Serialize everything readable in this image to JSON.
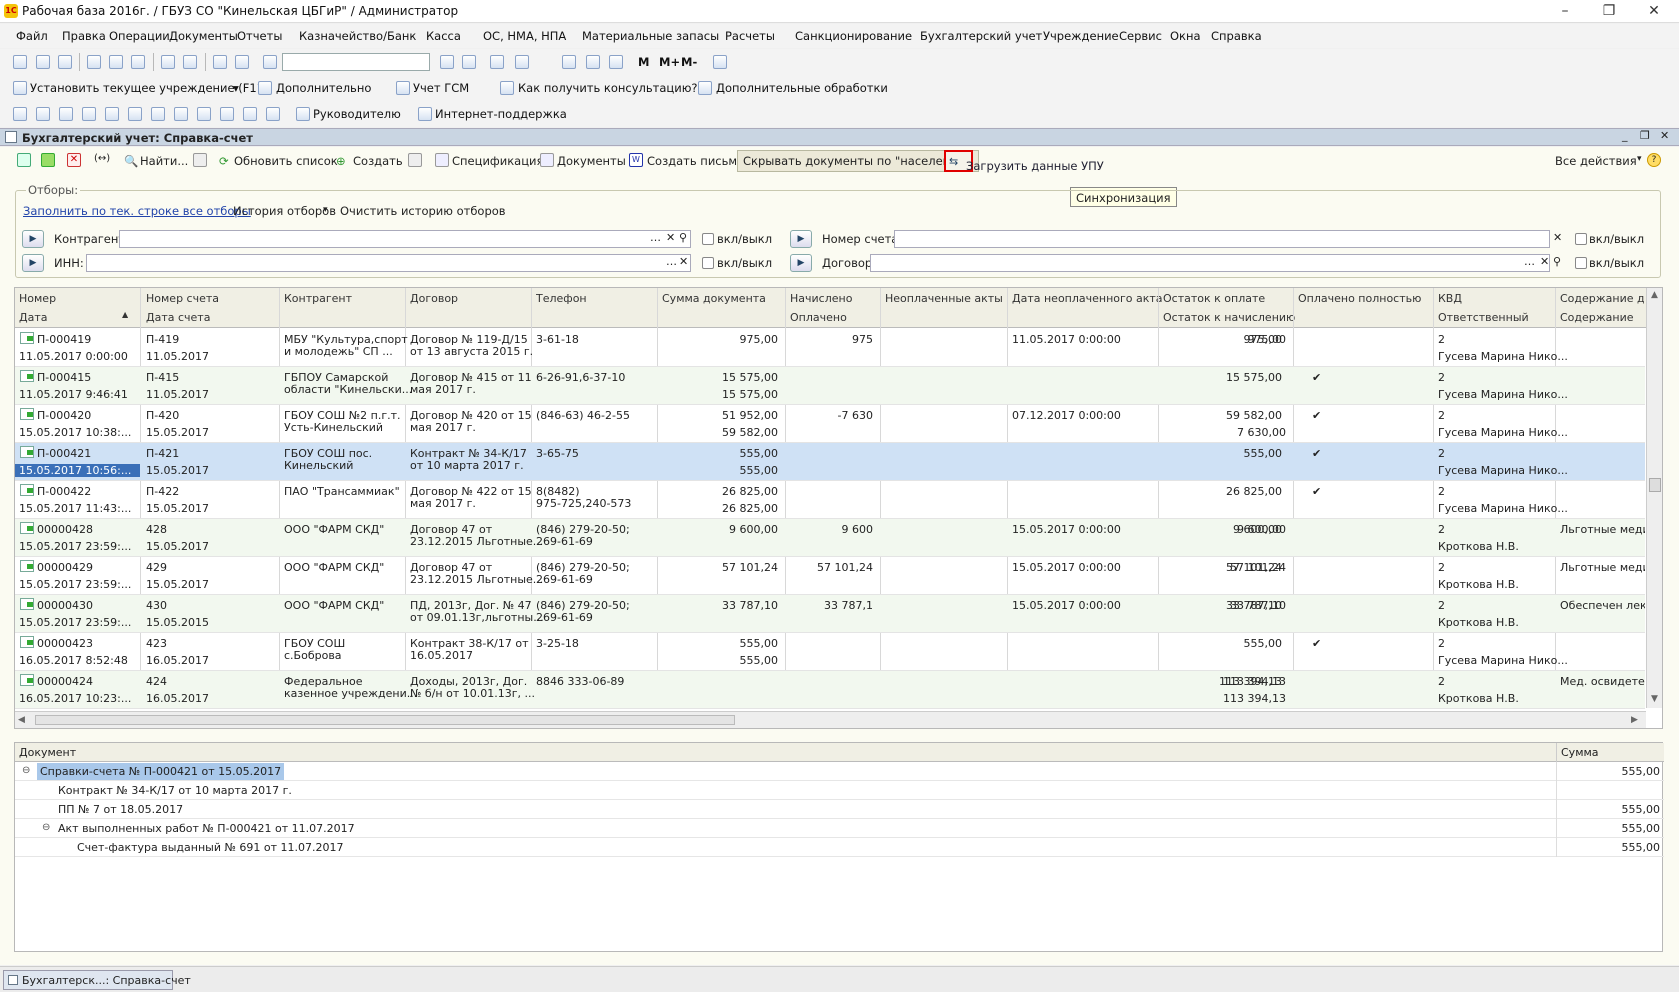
{
  "window": {
    "title": "Рабочая база 2016г. / ГБУЗ СО \"Кинельская ЦБГиР\" / Администратор"
  },
  "menu": [
    "Файл",
    "Правка",
    "Операции",
    "Документы",
    "Отчеты",
    "Казначейство/Банк",
    "Касса",
    "ОС, НМА, НПА",
    "Материальные запасы",
    "Расчеты",
    "Санкционирование",
    "Бухгалтерский учет",
    "Учреждение",
    "Сервис",
    "Окна",
    "Справка"
  ],
  "toolbar2": {
    "set_institution": "Установить текущее учреждение (F11)",
    "additional": "Дополнительно",
    "gsm": "Учет ГСМ",
    "consult": "Как получить консультацию?",
    "processing": "Дополнительные обработки"
  },
  "toolbar3": {
    "manager": "Руководителю",
    "support": "Интернет-поддержка"
  },
  "form": {
    "title": "Бухгалтерский учет: Справка-счет",
    "find": "Найти...",
    "refresh": "Обновить список",
    "create": "Создать",
    "spec": "Спецификация",
    "docs": "Документы",
    "letter": "Создать письмо",
    "hide_pop": "Скрывать документы по \"населению\"",
    "load_upu": "Загрузить данные УПУ",
    "all_actions": "Все действия",
    "tooltip": "Синхронизация"
  },
  "filters": {
    "legend": "Отборы:",
    "fill": "Заполнить по тек. строке все отборы",
    "history": "История отборов",
    "clear": "Очистить историю отборов",
    "contragent": "Контрагент:",
    "inn": "ИНН:",
    "account": "Номер счета:",
    "contract": "Договор:",
    "toggle": "вкл/выкл"
  },
  "columns_top": [
    "Номер",
    "Номер счета",
    "Контрагент",
    "Договор",
    "Телефон",
    "Сумма документа",
    "Начислено",
    "Неоплаченные акты",
    "Дата неоплаченного акта",
    "Остаток к оплате",
    "Оплачено полностью",
    "КВД",
    "Содержание до"
  ],
  "columns_bot": [
    "Дата",
    "Дата счета",
    "",
    "",
    "",
    "",
    "Оплачено",
    "",
    "",
    "Остаток к начислению",
    "",
    "Ответственный",
    "Содержание"
  ],
  "rows": [
    {
      "num": "П-000419",
      "date": "11.05.2017 0:00:00",
      "acc": "П-419",
      "accdate": "11.05.2017",
      "ca1": "МБУ \"Культура,спорт",
      "ca2": "и молодежь\" СП ...",
      "ct1": "Договор № 119-Д/15",
      "ct2": "от 13 августа 2015 г.",
      "ph1": "3-61-18",
      "ph2": "",
      "sum": "975,00",
      "nach": "975,00",
      "opl": "",
      "unp": "975",
      "unpd": "11.05.2017 0:00:00",
      "ost": "975,00",
      "ostn": "",
      "full": "",
      "kvd": "2",
      "resp": "Гусева Марина Нико...",
      "cont": ""
    },
    {
      "num": "П-000415",
      "date": "11.05.2017 9:46:41",
      "acc": "П-415",
      "accdate": "11.05.2017",
      "ca1": "ГБПОУ  Самарской",
      "ca2": "области \"Кинельски...",
      "ct1": "Договор № 415 от 11",
      "ct2": "мая 2017 г.",
      "ph1": "6-26-91,6-37-10",
      "ph2": "",
      "sum": "15 575,00",
      "nach": "15 575,00",
      "opl": "15 575,00",
      "unp": "",
      "unpd": "",
      "ost": "",
      "ostn": "",
      "full": "✔",
      "kvd": "2",
      "resp": "Гусева Марина Нико...",
      "cont": ""
    },
    {
      "num": "П-000420",
      "date": "15.05.2017 10:38:...",
      "acc": "П-420",
      "accdate": "15.05.2017",
      "ca1": "ГБОУ СОШ №2 п.г.т.",
      "ca2": "Усть-Кинельский",
      "ct1": "Договор № 420 от 15",
      "ct2": "мая 2017 г.",
      "ph1": "(846-63) 46-2-55",
      "ph2": "",
      "sum": "59 582,00",
      "nach": "51 952,00",
      "opl": "59 582,00",
      "unp": "-7 630",
      "unpd": "07.12.2017 0:00:00",
      "ost": "",
      "ostn": "7 630,00",
      "full": "✔",
      "kvd": "2",
      "resp": "Гусева Марина Нико...",
      "cont": ""
    },
    {
      "num": "П-000421",
      "date": "15.05.2017 10:56:...",
      "acc": "П-421",
      "accdate": "15.05.2017",
      "ca1": "ГБОУ СОШ пос.",
      "ca2": "Кинельский",
      "ct1": "Контракт № 34-К/17",
      "ct2": "от 10 марта 2017 г.",
      "ph1": "3-65-75",
      "ph2": "",
      "sum": "555,00",
      "nach": "555,00",
      "opl": "555,00",
      "unp": "",
      "unpd": "",
      "ost": "",
      "ostn": "",
      "full": "✔",
      "kvd": "2",
      "resp": "Гусева Марина Нико...",
      "cont": ""
    },
    {
      "num": "П-000422",
      "date": "15.05.2017 11:43:...",
      "acc": "П-422",
      "accdate": "15.05.2017",
      "ca1": "ПАО \"Трансаммиак\"",
      "ca2": "",
      "ct1": "Договор № 422 от 15",
      "ct2": "мая 2017 г.",
      "ph1": "8(8482)",
      "ph2": "975-725,240-573",
      "sum": "26 825,00",
      "nach": "26 825,00",
      "opl": "26 825,00",
      "unp": "",
      "unpd": "",
      "ost": "",
      "ostn": "",
      "full": "✔",
      "kvd": "2",
      "resp": "Гусева Марина Нико...",
      "cont": ""
    },
    {
      "num": "00000428",
      "date": "15.05.2017 23:59:...",
      "acc": "428",
      "accdate": "15.05.2017",
      "ca1": "ООО \"ФАРМ СКД\"",
      "ca2": "",
      "ct1": "Договор 47 от",
      "ct2": "23.12.2015 Льготные...",
      "ph1": "(846) 279-20-50;",
      "ph2": "269-61-69",
      "sum": "9 600,00",
      "nach": "9 600,00",
      "opl": "",
      "unp": "9 600",
      "unpd": "15.05.2017 0:00:00",
      "ost": "9 600,00",
      "ostn": "",
      "full": "",
      "kvd": "2",
      "resp": "Кроткова Н.В.",
      "cont": "Льготные меди"
    },
    {
      "num": "00000429",
      "date": "15.05.2017 23:59:...",
      "acc": "429",
      "accdate": "15.05.2017",
      "ca1": "ООО \"ФАРМ СКД\"",
      "ca2": "",
      "ct1": "Договор 47 от",
      "ct2": "23.12.2015 Льготные...",
      "ph1": "(846) 279-20-50;",
      "ph2": "269-61-69",
      "sum": "57 101,24",
      "nach": "57 101,24",
      "opl": "",
      "unp": "57 101,24",
      "unpd": "15.05.2017 0:00:00",
      "ost": "57 101,24",
      "ostn": "",
      "full": "",
      "kvd": "2",
      "resp": "Кроткова Н.В.",
      "cont": "Льготные меди"
    },
    {
      "num": "00000430",
      "date": "15.05.2017 23:59:...",
      "acc": "430",
      "accdate": "15.05.2015",
      "ca1": "ООО \"ФАРМ СКД\"",
      "ca2": "",
      "ct1": "ПД, 2013г, Дог. № 47",
      "ct2": "от 09.01.13г,льготны...",
      "ph1": "(846) 279-20-50;",
      "ph2": "269-61-69",
      "sum": "33 787,10",
      "nach": "33 787,10",
      "opl": "",
      "unp": "33 787,1",
      "unpd": "15.05.2017 0:00:00",
      "ost": "33 787,10",
      "ostn": "",
      "full": "",
      "kvd": "2",
      "resp": "Кроткова Н.В.",
      "cont": "Обеспечен лека"
    },
    {
      "num": "00000423",
      "date": "16.05.2017 8:52:48",
      "acc": "423",
      "accdate": "16.05.2017",
      "ca1": "ГБОУ СОШ",
      "ca2": "с.Боброва",
      "ct1": "Контракт 38-К/17 от",
      "ct2": "16.05.2017",
      "ph1": "3-25-18",
      "ph2": "",
      "sum": "555,00",
      "nach": "555,00",
      "opl": "555,00",
      "unp": "",
      "unpd": "",
      "ost": "",
      "ostn": "",
      "full": "✔",
      "kvd": "2",
      "resp": "Гусева Марина Нико...",
      "cont": ""
    },
    {
      "num": "00000424",
      "date": "16.05.2017 10:23:...",
      "acc": "424",
      "accdate": "16.05.2017",
      "ca1": "Федеральное",
      "ca2": "казенное учреждени...",
      "ct1": "Доходы, 2013г, Дог.",
      "ct2": "№ б/н от 10.01.13г, ...",
      "ph1": "8846 333-06-89",
      "ph2": "",
      "sum": "113 394,13",
      "nach": "",
      "opl": "",
      "unp": "",
      "unpd": "",
      "ost": "113 394,13",
      "ostn": "113 394,13",
      "full": "",
      "kvd": "2",
      "resp": "Кроткова Н.В.",
      "cont": "Мед. освидетел"
    }
  ],
  "detail": {
    "col_doc": "Документ",
    "col_sum": "Сумма",
    "rows": [
      {
        "label": "Справки-счета № П-000421 от 15.05.2017",
        "sum": "555,00"
      },
      {
        "label": "Контракт № 34-К/17 от 10 марта 2017 г.",
        "sum": ""
      },
      {
        "label": "ПП № 7 от 18.05.2017",
        "sum": "555,00"
      },
      {
        "label": "Акт выполненных работ № П-000421 от 11.07.2017",
        "sum": "555,00"
      },
      {
        "label": "Счет-фактура выданный № 691 от 11.07.2017",
        "sum": "555,00"
      }
    ]
  },
  "taskbar": {
    "item": "Бухгалтерск...: Справка-счет"
  }
}
